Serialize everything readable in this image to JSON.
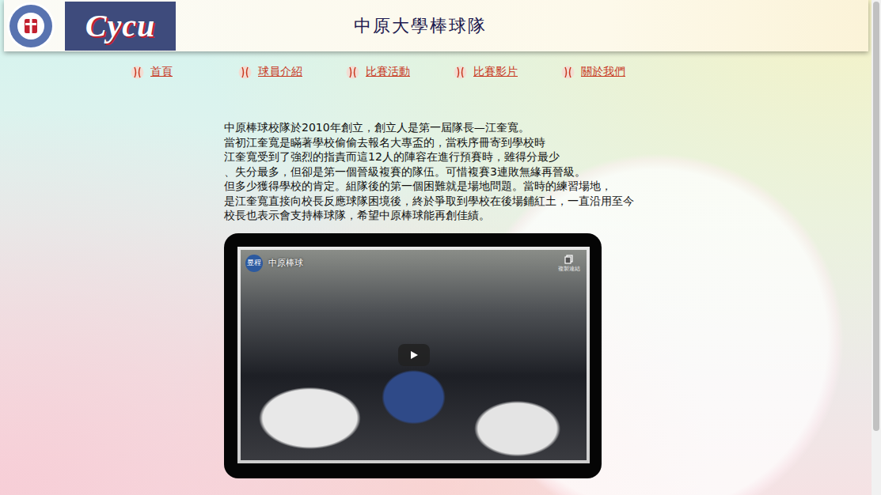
{
  "header": {
    "logo_text": "Cycu",
    "title": "中原大學棒球隊"
  },
  "nav": [
    {
      "label": "首頁"
    },
    {
      "label": "球員介紹"
    },
    {
      "label": "比賽活動"
    },
    {
      "label": "比賽影片"
    },
    {
      "label": "關於我們"
    }
  ],
  "intro": {
    "lines": [
      "中原棒球校隊於2010年創立，創立人是第一屆隊長—江奎寬。",
      "當初江奎寬是瞞著學校偷偷去報名大專盃的，當秩序冊寄到學校時",
      "江奎寬受到了強烈的指責而這12人的陣容在進行預賽時，雖得分最少",
      "、失分最多，但卻是第一個晉級複賽的隊伍。可惜複賽3連敗無緣再晉級。",
      "但多少獲得學校的肯定。組隊後的第一個困難就是場地問題。當時的練習場地，",
      "是江奎寬直接向校長反應球隊困境後，終於爭取到學校在後場鋪紅土，一直沿用至今",
      "校長也表示會支持棒球隊，希望中原棒球能再創佳績。"
    ]
  },
  "video": {
    "channel_avatar": "昱程",
    "title": "中原棒球",
    "copy_label": "複製連結"
  }
}
